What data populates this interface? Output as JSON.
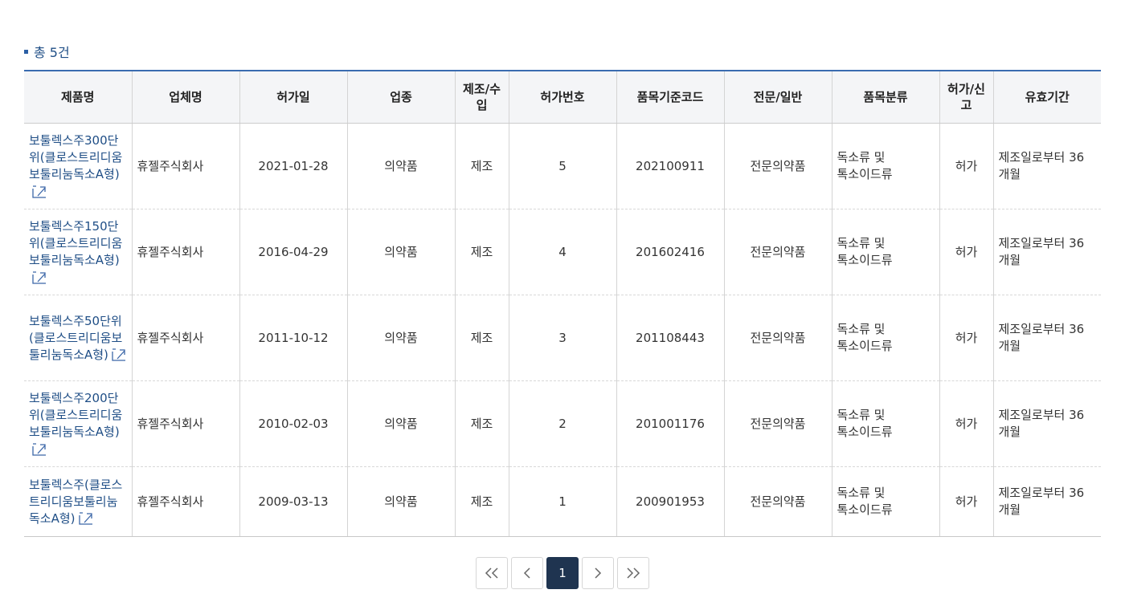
{
  "summary": {
    "label": "총 5건"
  },
  "table": {
    "headers": [
      "제품명",
      "업체명",
      "허가일",
      "업종",
      "제조/수입",
      "허가번호",
      "품목기준코드",
      "전문/일반",
      "품목분류",
      "허가/신고",
      "유효기간"
    ],
    "rows": [
      [
        "보툴렉스주300단위(클로스트리디움보툴리눔독소A형)",
        "휴젤주식회사",
        "2021-01-28",
        "의약품",
        "제조",
        "5",
        "202100911",
        "전문의약품",
        "독소류 및 톡소이드류",
        "허가",
        "제조일로부터 36 개월"
      ],
      [
        "보툴렉스주150단위(클로스트리디움보툴리눔독소A형)",
        "휴젤주식회사",
        "2016-04-29",
        "의약품",
        "제조",
        "4",
        "201602416",
        "전문의약품",
        "독소류 및 톡소이드류",
        "허가",
        "제조일로부터 36 개월"
      ],
      [
        "보툴렉스주50단위(클로스트리디움보툴리눔독소A형)",
        "휴젤주식회사",
        "2011-10-12",
        "의약품",
        "제조",
        "3",
        "201108443",
        "전문의약품",
        "독소류 및 톡소이드류",
        "허가",
        "제조일로부터 36 개월"
      ],
      [
        "보툴렉스주200단위(클로스트리디움보툴리눔독소A형)",
        "휴젤주식회사",
        "2010-02-03",
        "의약품",
        "제조",
        "2",
        "201001176",
        "전문의약품",
        "독소류 및 톡소이드류",
        "허가",
        "제조일로부터 36 개월"
      ],
      [
        "보툴렉스주(클로스트리디움보툴리눔독소A형)",
        "휴젤주식회사",
        "2009-03-13",
        "의약품",
        "제조",
        "1",
        "200901953",
        "전문의약품",
        "독소류 및 톡소이드류",
        "허가",
        "제조일로부터 36 개월"
      ]
    ]
  },
  "pagination": {
    "first_icon": "double-chevron-left-icon",
    "prev_icon": "chevron-left-icon",
    "current_page": "1",
    "next_icon": "chevron-right-icon",
    "last_icon": "double-chevron-right-icon"
  },
  "colors": {
    "accent": "#1f4e86",
    "header_bg": "#f4f5f7",
    "active_page": "#1f3450"
  },
  "icons": {
    "external_link": "external-link-icon"
  }
}
